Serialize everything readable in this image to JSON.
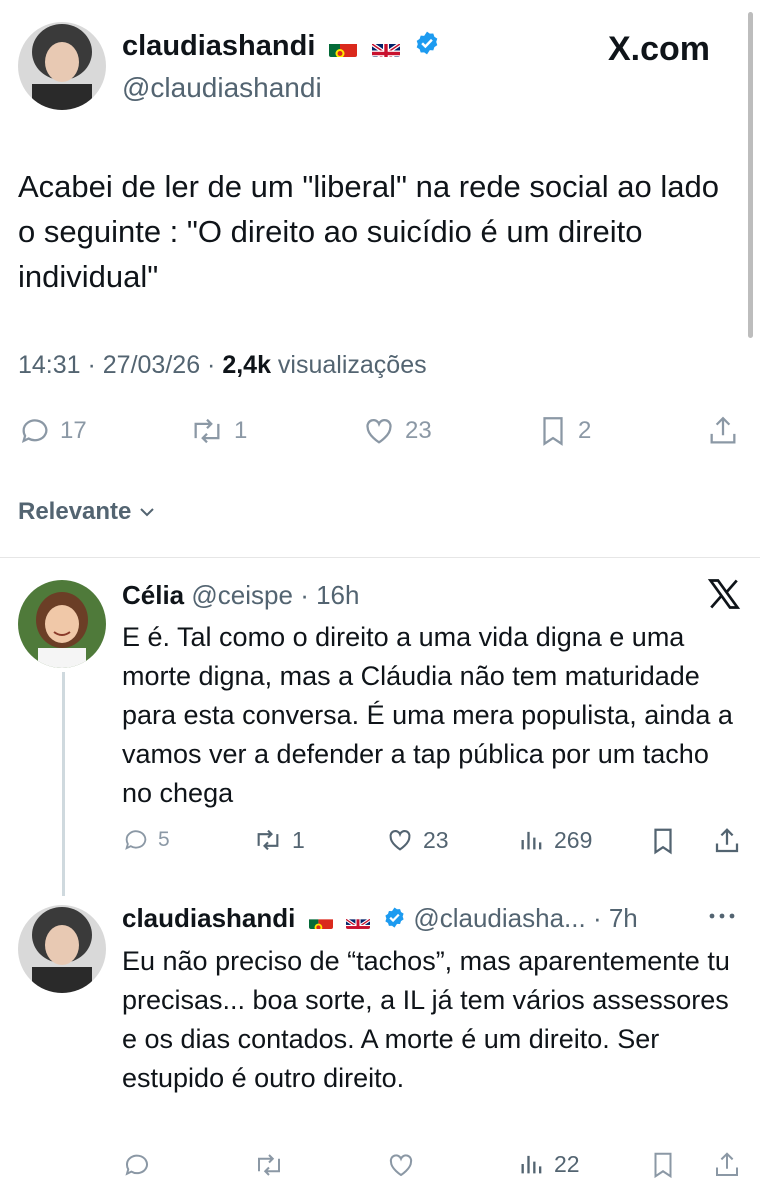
{
  "main_tweet": {
    "display_name": "claudiashandi",
    "handle": "@claudiashandi",
    "source": "X.com",
    "text": "Acabei de ler de um \"liberal\" na rede social ao lado o seguinte : \"O direito ao suicídio é um direito individual\"",
    "time": "14:31 · 27/03/26 · ",
    "views_count": "2,4k",
    "views_label": " visualizações",
    "replies": "17",
    "reposts": "1",
    "likes": "23",
    "bookmarks": "2"
  },
  "sort": {
    "label": "Relevante"
  },
  "reply1": {
    "display_name": "Célia",
    "handle": "@ceispe",
    "time": "· 16h",
    "text": "E é. Tal como o direito a uma vida digna e uma morte digna, mas a Cláudia não tem maturidade para esta conversa. É uma mera populista, ainda a vamos ver a defender a tap pública por um tacho no chega",
    "replies": "5",
    "reposts": "1",
    "likes": "23",
    "views": "269"
  },
  "reply2": {
    "display_name": "claudiashandi",
    "handle": "@claudiasha...",
    "time": "· 7h",
    "text": "Eu não preciso de “tachos”, mas aparentemente tu precisas... boa sorte, a IL já tem vários assessores e os dias contados. A morte é um direito. Ser estupido é outro direito.",
    "views": "22"
  },
  "colors": {
    "verified": "#1d9bf0",
    "text": "#0f1419",
    "secondary": "#536471",
    "thread_line": "#cfd9de"
  }
}
